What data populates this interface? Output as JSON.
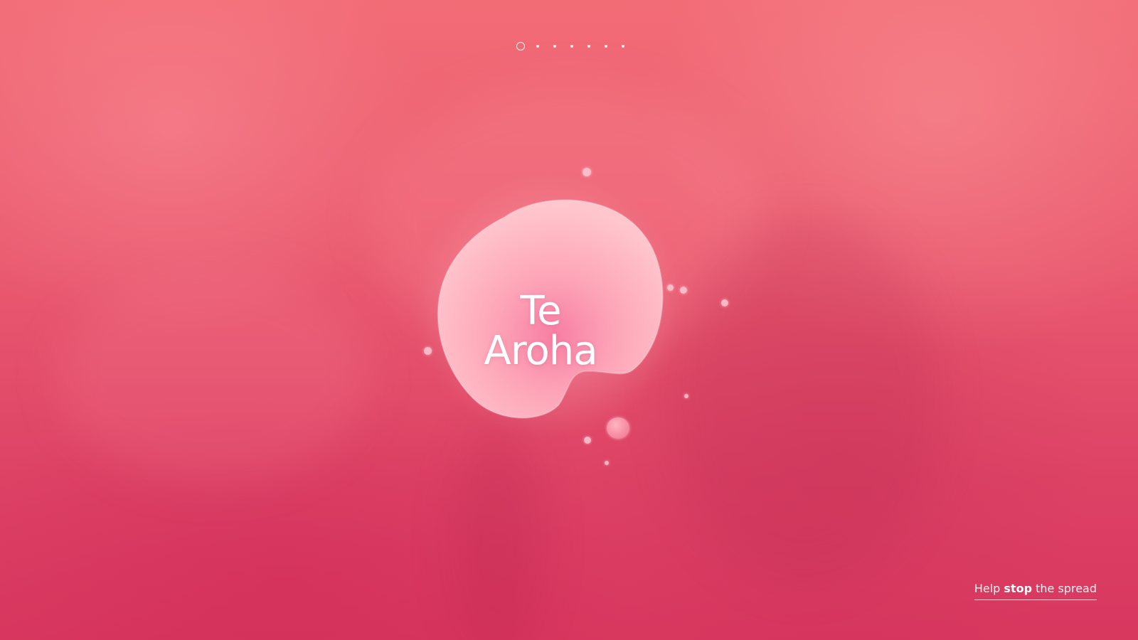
{
  "page": {
    "title": "Te Aroha",
    "background_color": "#e24f6b",
    "accent_color": "#ffffff"
  },
  "pager": {
    "total": 7,
    "current": 1
  },
  "hero": {
    "title": "Te Aroha"
  },
  "footer_link": {
    "part1": "Help ",
    "part2": "stop",
    "part3": " the spread"
  }
}
